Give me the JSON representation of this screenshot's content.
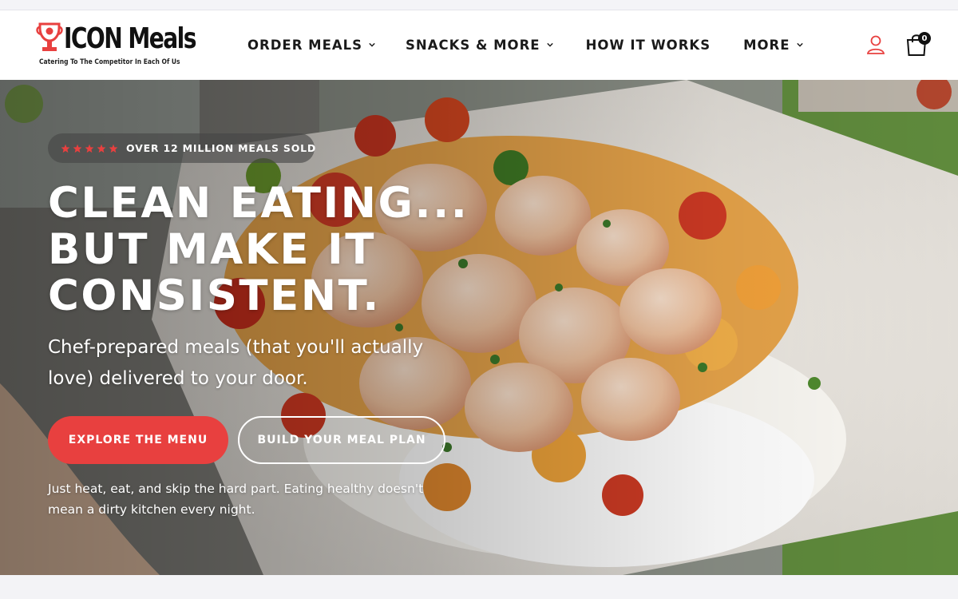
{
  "brand": {
    "name": "ICON Meals",
    "tagline": "Catering To The Competitor In Each Of Us",
    "accent_color": "#e8403f",
    "logo_icon": "trophy-icon"
  },
  "nav": {
    "items": [
      {
        "label": "ORDER MEALS",
        "has_dropdown": true
      },
      {
        "label": "SNACKS & MORE",
        "has_dropdown": true
      },
      {
        "label": "HOW IT WORKS",
        "has_dropdown": false
      },
      {
        "label": "MORE",
        "has_dropdown": true
      }
    ]
  },
  "header_actions": {
    "account_icon": "user-icon",
    "cart_icon": "shopping-bag-icon",
    "cart_count": "0"
  },
  "hero": {
    "badge": {
      "stars": 5,
      "star_color": "#e8403f",
      "text": "OVER 12 MILLION MEALS SOLD"
    },
    "headline": [
      "CLEAN EATING...",
      "BUT MAKE IT",
      "CONSISTENT."
    ],
    "subhead": "Chef-prepared meals (that you'll actually love) delivered to your door.",
    "primary_cta": "EXPLORE THE MENU",
    "secondary_cta": "BUILD YOUR MEAL PLAN",
    "note": "Just heat, eat, and skip the hard part. Eating healthy doesn't mean a dirty kitchen every night."
  }
}
